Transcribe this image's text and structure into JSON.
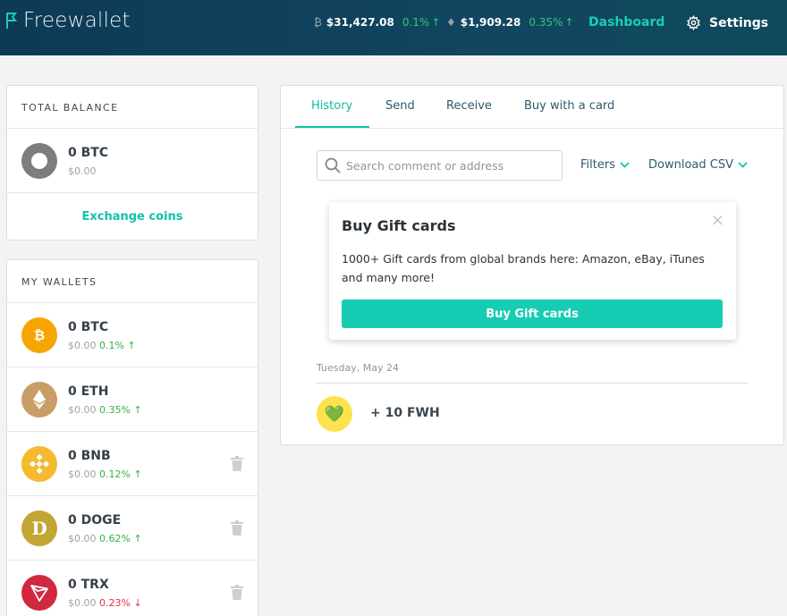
{
  "header": {
    "logo_text": "Freewallet",
    "tickers": [
      {
        "icon": "bitcoin-icon",
        "price": "$31,427.08",
        "change": "0.1%",
        "arrow": "↑"
      },
      {
        "icon": "ethereum-icon",
        "price": "$1,909.28",
        "change": "0.35%",
        "arrow": "↑"
      }
    ],
    "nav": {
      "dashboard": "Dashboard",
      "settings": "Settings"
    }
  },
  "total_balance": {
    "title": "TOTAL BALANCE",
    "amount": "0 BTC",
    "fiat": "$0.00",
    "exchange_label": "Exchange coins"
  },
  "wallets": {
    "title": "MY WALLETS",
    "items": [
      {
        "amount": "0 BTC",
        "fiat": "$0.00",
        "change": "0.1%",
        "arrow": "↑",
        "color": "#f7a600",
        "symbol": "₿"
      },
      {
        "amount": "0 ETH",
        "fiat": "$0.00",
        "change": "0.35%",
        "arrow": "↑",
        "color": "#c99d66",
        "symbol": "♦"
      },
      {
        "amount": "0 BNB",
        "fiat": "$0.00",
        "change": "0.12%",
        "arrow": "↑",
        "color": "#f3ba2f",
        "symbol": "◈"
      },
      {
        "amount": "0 DOGE",
        "fiat": "$0.00",
        "change": "0.62%",
        "arrow": "↑",
        "color": "#c2a633",
        "symbol": "D"
      },
      {
        "amount": "0 TRX",
        "fiat": "$0.00",
        "change": "0.23%",
        "arrow": "↓",
        "color": "#d0283f",
        "symbol": "▽"
      }
    ]
  },
  "tabs": [
    "History",
    "Send",
    "Receive",
    "Buy with a card"
  ],
  "search": {
    "placeholder": "Search comment or address"
  },
  "filters_label": "Filters",
  "download_label": "Download CSV",
  "promo": {
    "title": "Buy Gift cards",
    "text": "1000+ Gift cards from global brands here: Amazon, eBay, iTunes and many more!",
    "button": "Buy Gift cards",
    "close": "×"
  },
  "history": {
    "date": "Tuesday, May 24",
    "transactions": [
      {
        "icon": "💚",
        "amount": "+ 10 FWH"
      }
    ]
  }
}
